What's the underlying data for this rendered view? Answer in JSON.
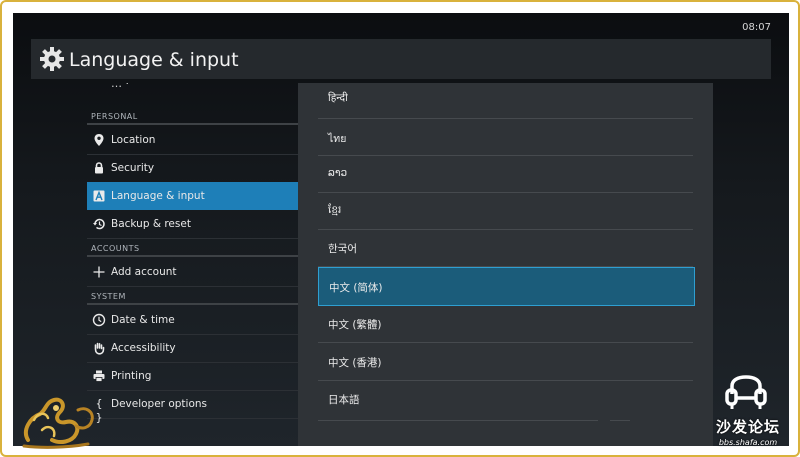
{
  "status_bar": {
    "time": "08:07"
  },
  "action_bar": {
    "title": "Language & input",
    "icon": "gear-icon"
  },
  "settings": {
    "cut_item": "…  ·",
    "sections": {
      "personal": "PERSONAL",
      "accounts": "ACCOUNTS",
      "system": "SYSTEM"
    },
    "items": [
      {
        "label": "Location",
        "icon": "location-pin-icon",
        "selected": false
      },
      {
        "label": "Security",
        "icon": "lock-icon",
        "selected": false
      },
      {
        "label": "Language & input",
        "icon": "language-a-icon",
        "selected": true
      },
      {
        "label": "Backup & reset",
        "icon": "backup-restore-icon",
        "selected": false
      },
      {
        "label": "Add account",
        "icon": "plus-icon",
        "selected": false
      },
      {
        "label": "Date & time",
        "icon": "clock-icon",
        "selected": false
      },
      {
        "label": "Accessibility",
        "icon": "hand-icon",
        "selected": false
      },
      {
        "label": "Printing",
        "icon": "printer-icon",
        "selected": false
      },
      {
        "label": "Developer options",
        "icon": "braces-icon",
        "selected": false
      }
    ]
  },
  "language_dialog": {
    "languages": [
      {
        "label": "हिन्दी"
      },
      {
        "label": "ไทย"
      },
      {
        "label": "ລາວ"
      },
      {
        "label": "ខ្មែរ"
      },
      {
        "label": "한국어"
      },
      {
        "label": "中文 (简体)",
        "selected": true
      },
      {
        "label": "中文 (繁體)"
      },
      {
        "label": "中文 (香港)"
      },
      {
        "label": "日本語"
      }
    ]
  },
  "watermark": {
    "text": "沙发论坛",
    "url": "bbs.shafa.com"
  },
  "colors": {
    "accent": "#1e7fb8",
    "selected_language": "#1b5c7a",
    "frame": "#d9b23c"
  }
}
